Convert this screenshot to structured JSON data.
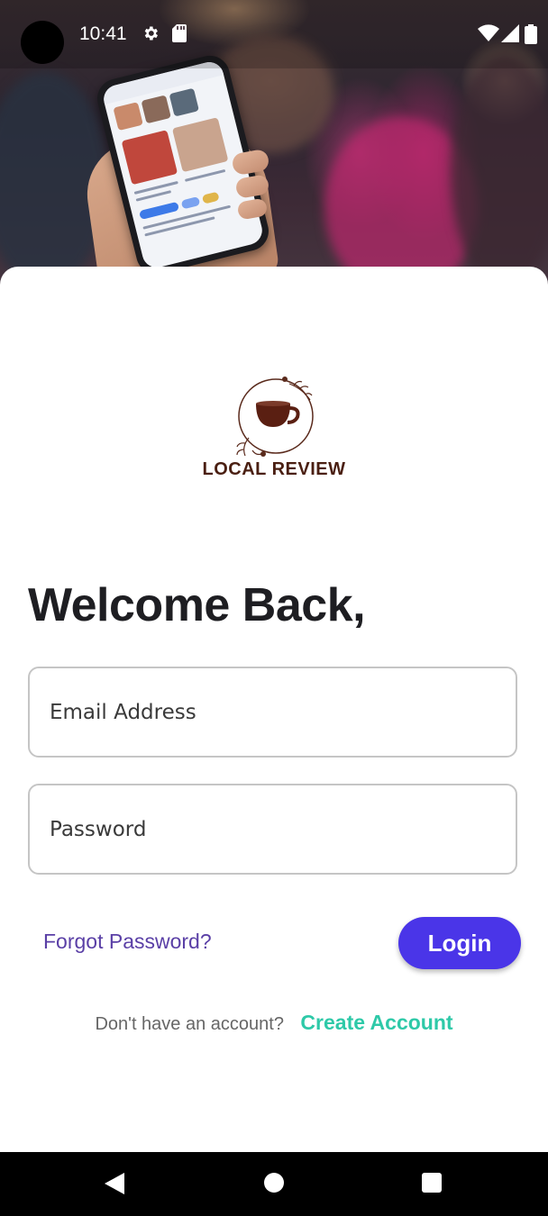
{
  "status_bar": {
    "time": "10:41",
    "icons": [
      "settings-icon",
      "sd-card-icon",
      "wifi-icon",
      "signal-icon",
      "battery-icon"
    ]
  },
  "brand": {
    "name": "LOCAL REVIEW",
    "color": "#4a1f12"
  },
  "login": {
    "heading": "Welcome Back,",
    "email_placeholder": "Email Address",
    "password_placeholder": "Password",
    "forgot_label": "Forgot Password?",
    "login_label": "Login",
    "signup_prompt": "Don't have an account?",
    "signup_label": "Create Account"
  },
  "colors": {
    "primary": "#4a35e8",
    "link_purple": "#5a3fa6",
    "accent_teal": "#2ec9a8",
    "field_border": "#c5c5c5"
  },
  "nav_bar": {
    "buttons": [
      "back-icon",
      "home-icon",
      "recents-icon"
    ]
  }
}
